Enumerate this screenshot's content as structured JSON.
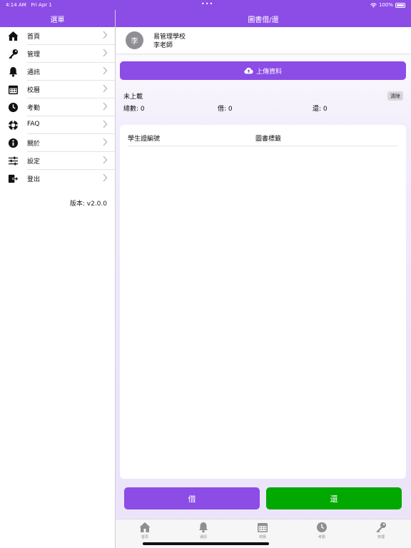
{
  "status_bar": {
    "time": "4:14 AM",
    "date": "Fri Apr 1",
    "battery": "100%"
  },
  "sidebar": {
    "title": "選單",
    "items": [
      {
        "label": "首頁",
        "icon": "home-icon"
      },
      {
        "label": "管理",
        "icon": "key-icon"
      },
      {
        "label": "通訊",
        "icon": "bell-icon"
      },
      {
        "label": "校曆",
        "icon": "calendar-icon"
      },
      {
        "label": "考勤",
        "icon": "clock-icon"
      },
      {
        "label": "FAQ",
        "icon": "lifebuoy-icon"
      },
      {
        "label": "關於",
        "icon": "info-icon"
      },
      {
        "label": "設定",
        "icon": "sliders-icon"
      },
      {
        "label": "登出",
        "icon": "logout-icon"
      }
    ],
    "version": "版本: v2.0.0"
  },
  "main": {
    "title": "圖書借/還",
    "avatar_text": "李",
    "school": "易管理學校",
    "teacher": "李老師",
    "upload_label": "上傳資料",
    "status": "未上載",
    "clear_label": "清除",
    "total": "總數: 0",
    "borrow_count": "借: 0",
    "return_count": "還: 0",
    "table_headers": [
      "學生證編號",
      "圖書標籤"
    ],
    "borrow_label": "借",
    "return_label": "還"
  },
  "tabbar": [
    {
      "label": "首頁",
      "icon": "home-icon"
    },
    {
      "label": "通訊",
      "icon": "bell-icon"
    },
    {
      "label": "校曆",
      "icon": "calendar-icon"
    },
    {
      "label": "考勤",
      "icon": "clock-icon"
    },
    {
      "label": "管理",
      "icon": "key-icon"
    }
  ],
  "colors": {
    "accent": "#8c4ce6",
    "return_green": "#00a800"
  }
}
